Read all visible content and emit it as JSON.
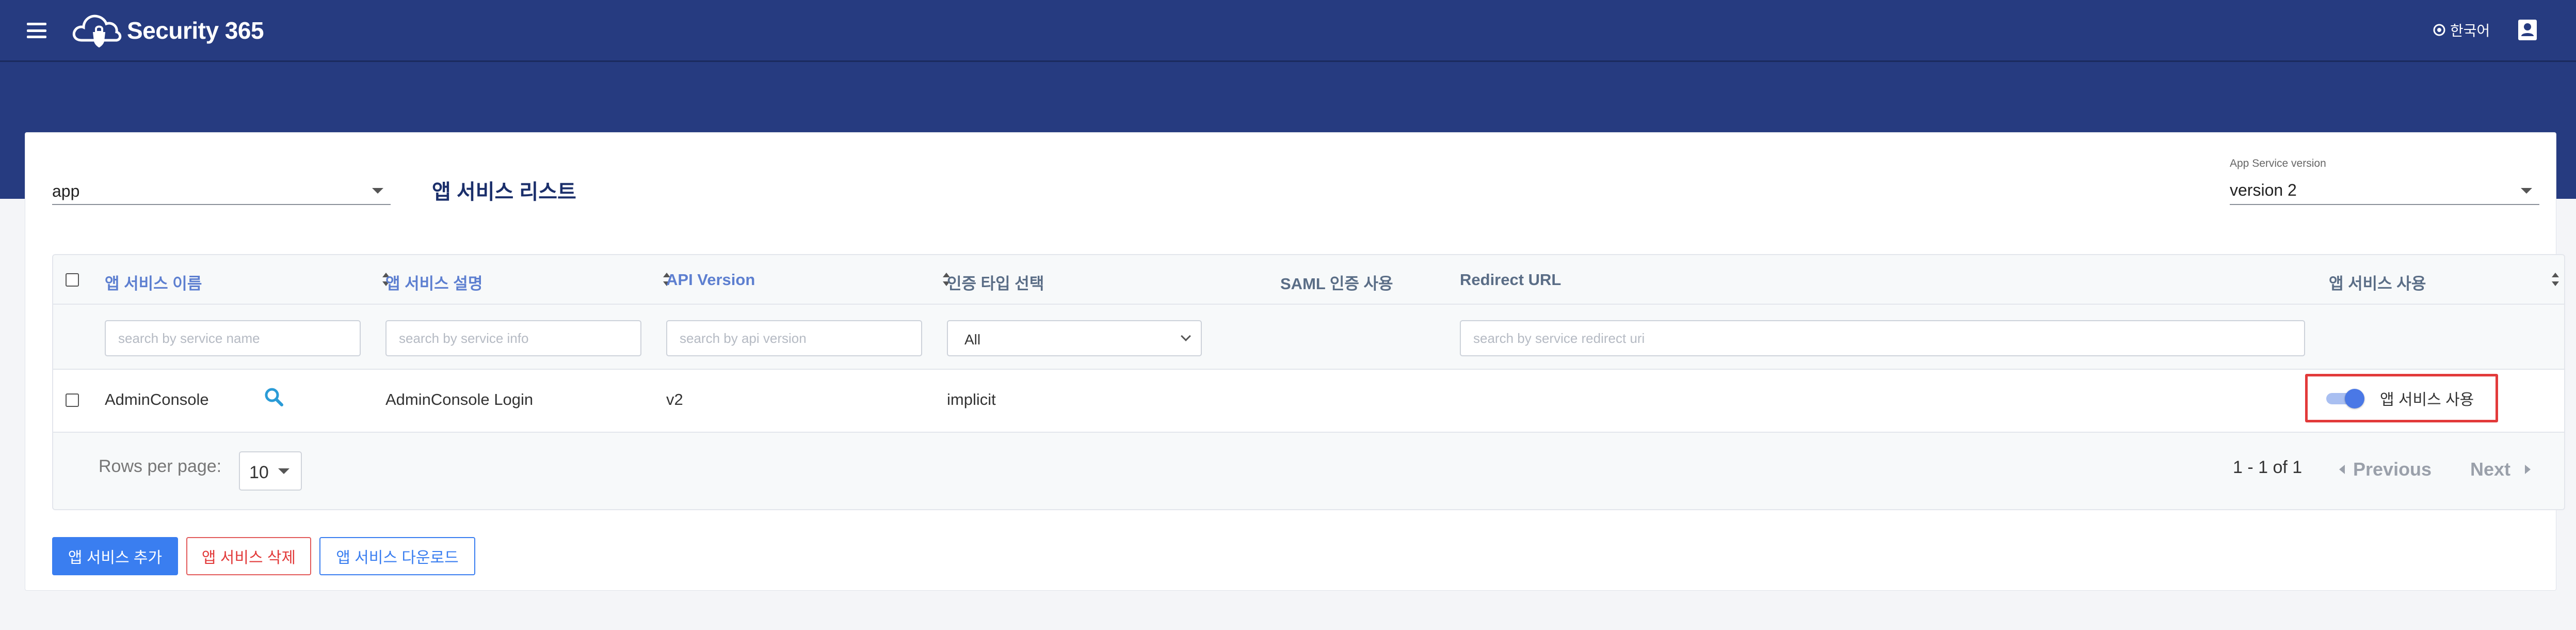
{
  "header": {
    "brand": "Security 365",
    "language": "한국어"
  },
  "selector": {
    "app_value": "app",
    "page_title": "앱 서비스 리스트",
    "version_label": "App Service version",
    "version_value": "version 2"
  },
  "table": {
    "columns": [
      "앱 서비스 이름",
      "앱 서비스 설명",
      "API Version",
      "인증 타입 선택",
      "SAML 인증 사용",
      "Redirect URL",
      "앱 서비스 사용"
    ],
    "filters": {
      "service_name_placeholder": "search by service name",
      "service_info_placeholder": "search by service info",
      "api_version_placeholder": "search by api version",
      "auth_type_value": "All",
      "redirect_url_placeholder": "search by service redirect uri"
    },
    "rows": [
      {
        "name": "AdminConsole",
        "description": "AdminConsole Login",
        "api_version": "v2",
        "auth_type": "implicit",
        "saml": "",
        "redirect_url": "",
        "enabled": true,
        "enabled_label": "앱 서비스 사용"
      }
    ]
  },
  "pagination": {
    "rows_per_page_label": "Rows per page:",
    "rows_per_page_value": "10",
    "range": "1 - 1 of 1",
    "previous": "Previous",
    "next": "Next"
  },
  "actions": {
    "add": "앱 서비스 추가",
    "delete": "앱 서비스 삭제",
    "download": "앱 서비스 다운로드"
  },
  "colors": {
    "header_bg": "#263b80",
    "primary": "#3a7ef0",
    "danger": "#e23a3a",
    "highlight_box": "#e23a3a"
  },
  "icons": [
    "menu-icon",
    "cloud-lock-logo-icon",
    "globe-icon",
    "account-icon",
    "search-icon",
    "sort-icon",
    "chevron-down-icon",
    "chevron-left-icon",
    "chevron-right-icon"
  ]
}
